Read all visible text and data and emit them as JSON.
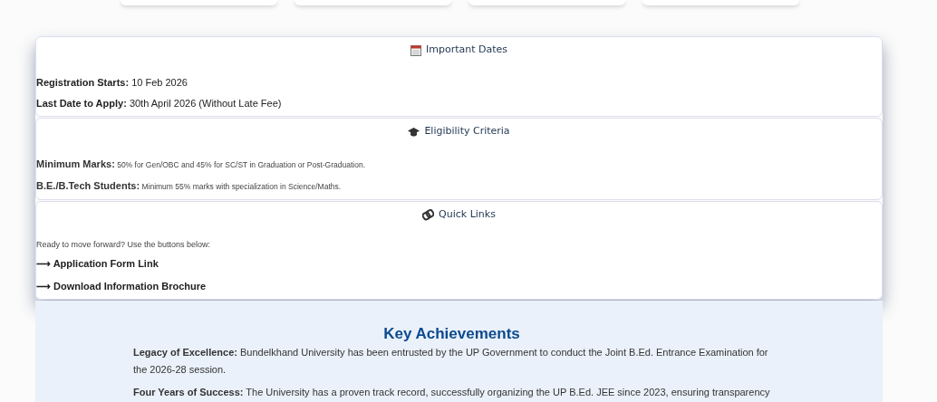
{
  "top_cards": [
    {
      "kind": "card"
    },
    {
      "kind": "card"
    },
    {
      "kind": "card"
    },
    {
      "kind": "card"
    }
  ],
  "sections": [
    {
      "kind": "dates",
      "title": "Important Dates",
      "items": [
        {
          "kind": "fact",
          "text": "**Registration Starts:** 10 Feb 2026"
        },
        {
          "kind": "fact",
          "text": "**Last Date to Apply:** 30th April 2026 (Without Late Fee)"
        }
      ]
    },
    {
      "kind": "eligibility",
      "title": "Eligibility Criteria",
      "items": [
        {
          "kind": "detail",
          "text": "**Minimum Marks:** 50% for Gen/OBC and 45% for SC/ST in Graduation or Post-Graduation."
        },
        {
          "kind": "detail",
          "text": "**B.E./B.Tech Students:** Minimum 55% marks with specialization in Science/Maths."
        }
      ]
    },
    {
      "kind": "links",
      "title": "Quick Links",
      "items": [
        {
          "kind": "note",
          "text": "Ready to move forward? Use the buttons below:"
        },
        {
          "kind": "link",
          "text": "⟶ Application Form Link"
        },
        {
          "kind": "link",
          "text": "⟶ Download Information Brochure"
        }
      ]
    }
  ],
  "achievements": {
    "title": "Key Achievements",
    "paragraphs": [
      "**Legacy of Excellence:** Bundelkhand University has been entrusted by the UP Government to conduct the Joint B.Ed. Entrance Examination for the 2026-28 session.",
      "**Four Years of Success:** The University has a proven track record, successfully organizing the UP B.Ed. JEE since 2023, ensuring transparency"
    ]
  }
}
